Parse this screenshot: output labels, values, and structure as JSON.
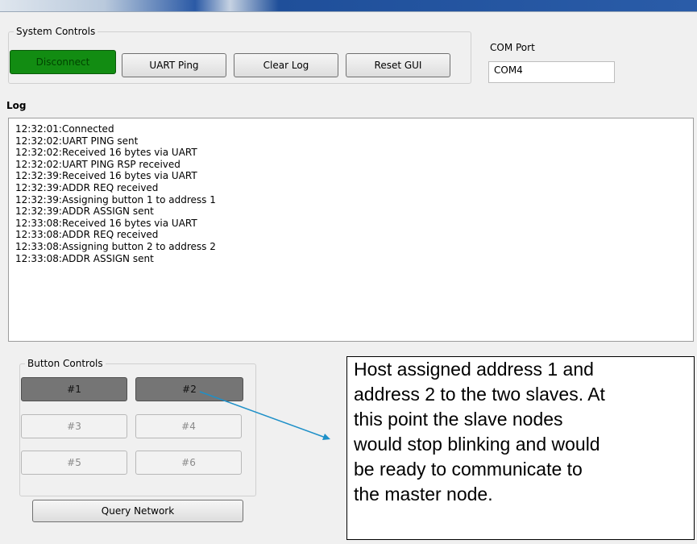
{
  "system_controls": {
    "title": "System Controls",
    "disconnect_label": "Disconnect",
    "uart_ping_label": "UART Ping",
    "clear_log_label": "Clear Log",
    "reset_gui_label": "Reset GUI"
  },
  "com_port": {
    "label": "COM Port",
    "value": "COM4"
  },
  "log": {
    "label": "Log",
    "lines": [
      "12:32:01:Connected",
      "12:32:02:UART PING sent",
      "12:32:02:Received 16 bytes via UART",
      "12:32:02:UART PING RSP received",
      "12:32:39:Received 16 bytes via UART",
      "12:32:39:ADDR REQ received",
      "12:32:39:Assigning button 1 to address 1",
      "12:32:39:ADDR ASSIGN sent",
      "12:33:08:Received 16 bytes via UART",
      "12:33:08:ADDR REQ received",
      "12:33:08:Assigning button 2 to address 2",
      "12:33:08:ADDR ASSIGN sent"
    ]
  },
  "button_controls": {
    "title": "Button Controls",
    "buttons": [
      {
        "label": "#1",
        "state": "assigned"
      },
      {
        "label": "#2",
        "state": "assigned"
      },
      {
        "label": "#3",
        "state": "unassigned"
      },
      {
        "label": "#4",
        "state": "unassigned"
      },
      {
        "label": "#5",
        "state": "unassigned"
      },
      {
        "label": "#6",
        "state": "unassigned"
      }
    ],
    "query_label": "Query Network"
  },
  "annotation": {
    "lines": [
      "Host assigned address 1 and",
      "address 2 to the two slaves. At",
      "this point the slave nodes",
      "would stop blinking and would",
      "be ready to  communicate to",
      "the master node."
    ]
  },
  "colors": {
    "connected_green": "#128c12",
    "assigned_gray": "#757575",
    "arrow_blue": "#1e90c8"
  }
}
